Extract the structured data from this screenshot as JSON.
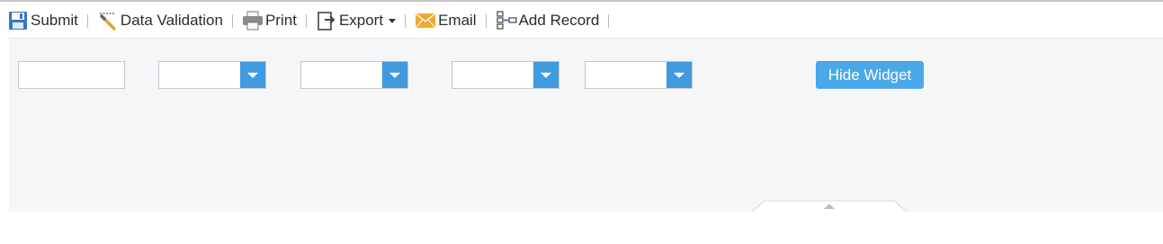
{
  "toolbar": {
    "items": [
      {
        "label": "Submit",
        "icon": "save-icon"
      },
      {
        "label": "Data Validation",
        "icon": "validation-wand-icon"
      },
      {
        "label": "Print",
        "icon": "printer-icon"
      },
      {
        "label": "Export",
        "icon": "export-icon"
      },
      {
        "label": "Email",
        "icon": "envelope-icon"
      },
      {
        "label": "Add Record",
        "icon": "add-record-icon"
      }
    ]
  },
  "widget": {
    "text_input_value": "",
    "dropdown_values": [
      "",
      "",
      "",
      ""
    ],
    "hide_label": "Hide Widget"
  },
  "colors": {
    "accent": "#4aa8e8",
    "dropdown_button": "#3f9ae0",
    "panel_bg": "#f5f6f8",
    "email_icon": "#f0a830",
    "save_icon": "#3b74c4"
  }
}
